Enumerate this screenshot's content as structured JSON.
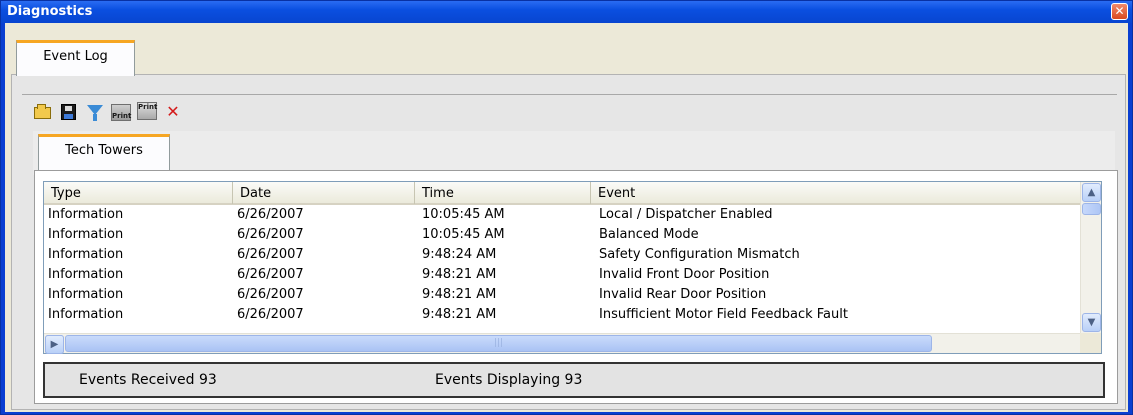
{
  "window": {
    "title": "Diagnostics",
    "close_glyph": "✕"
  },
  "tabs": {
    "outer": "Event Log",
    "inner": "Tech Towers"
  },
  "toolbar": {
    "print_label": "Print",
    "print_preview_label": "Print",
    "icons": [
      "folder-open-icon",
      "save-icon",
      "filter-icon",
      "print-icon",
      "print-preview-icon",
      "delete-icon"
    ]
  },
  "table": {
    "columns": [
      "Type",
      "Date",
      "Time",
      "Event"
    ],
    "rows": [
      {
        "type": "Information",
        "date": "6/26/2007",
        "time": "10:05:45 AM",
        "event": "Local / Dispatcher Enabled"
      },
      {
        "type": "Information",
        "date": "6/26/2007",
        "time": "10:05:45 AM",
        "event": "Balanced Mode"
      },
      {
        "type": "Information",
        "date": "6/26/2007",
        "time": "9:48:24 AM",
        "event": "Safety Configuration Mismatch"
      },
      {
        "type": "Information",
        "date": "6/26/2007",
        "time": "9:48:21 AM",
        "event": "Invalid Front Door Position"
      },
      {
        "type": "Information",
        "date": "6/26/2007",
        "time": "9:48:21 AM",
        "event": "Invalid Rear Door Position"
      },
      {
        "type": "Information",
        "date": "6/26/2007",
        "time": "9:48:21 AM",
        "event": "Insufficient Motor Field Feedback Fault"
      }
    ]
  },
  "status": {
    "received": "Events Received 93",
    "displaying": "Events Displaying 93"
  },
  "colors": {
    "title_bar": "#0a4fe0",
    "tab_accent": "#f6a623",
    "close_button": "#d9491f"
  }
}
